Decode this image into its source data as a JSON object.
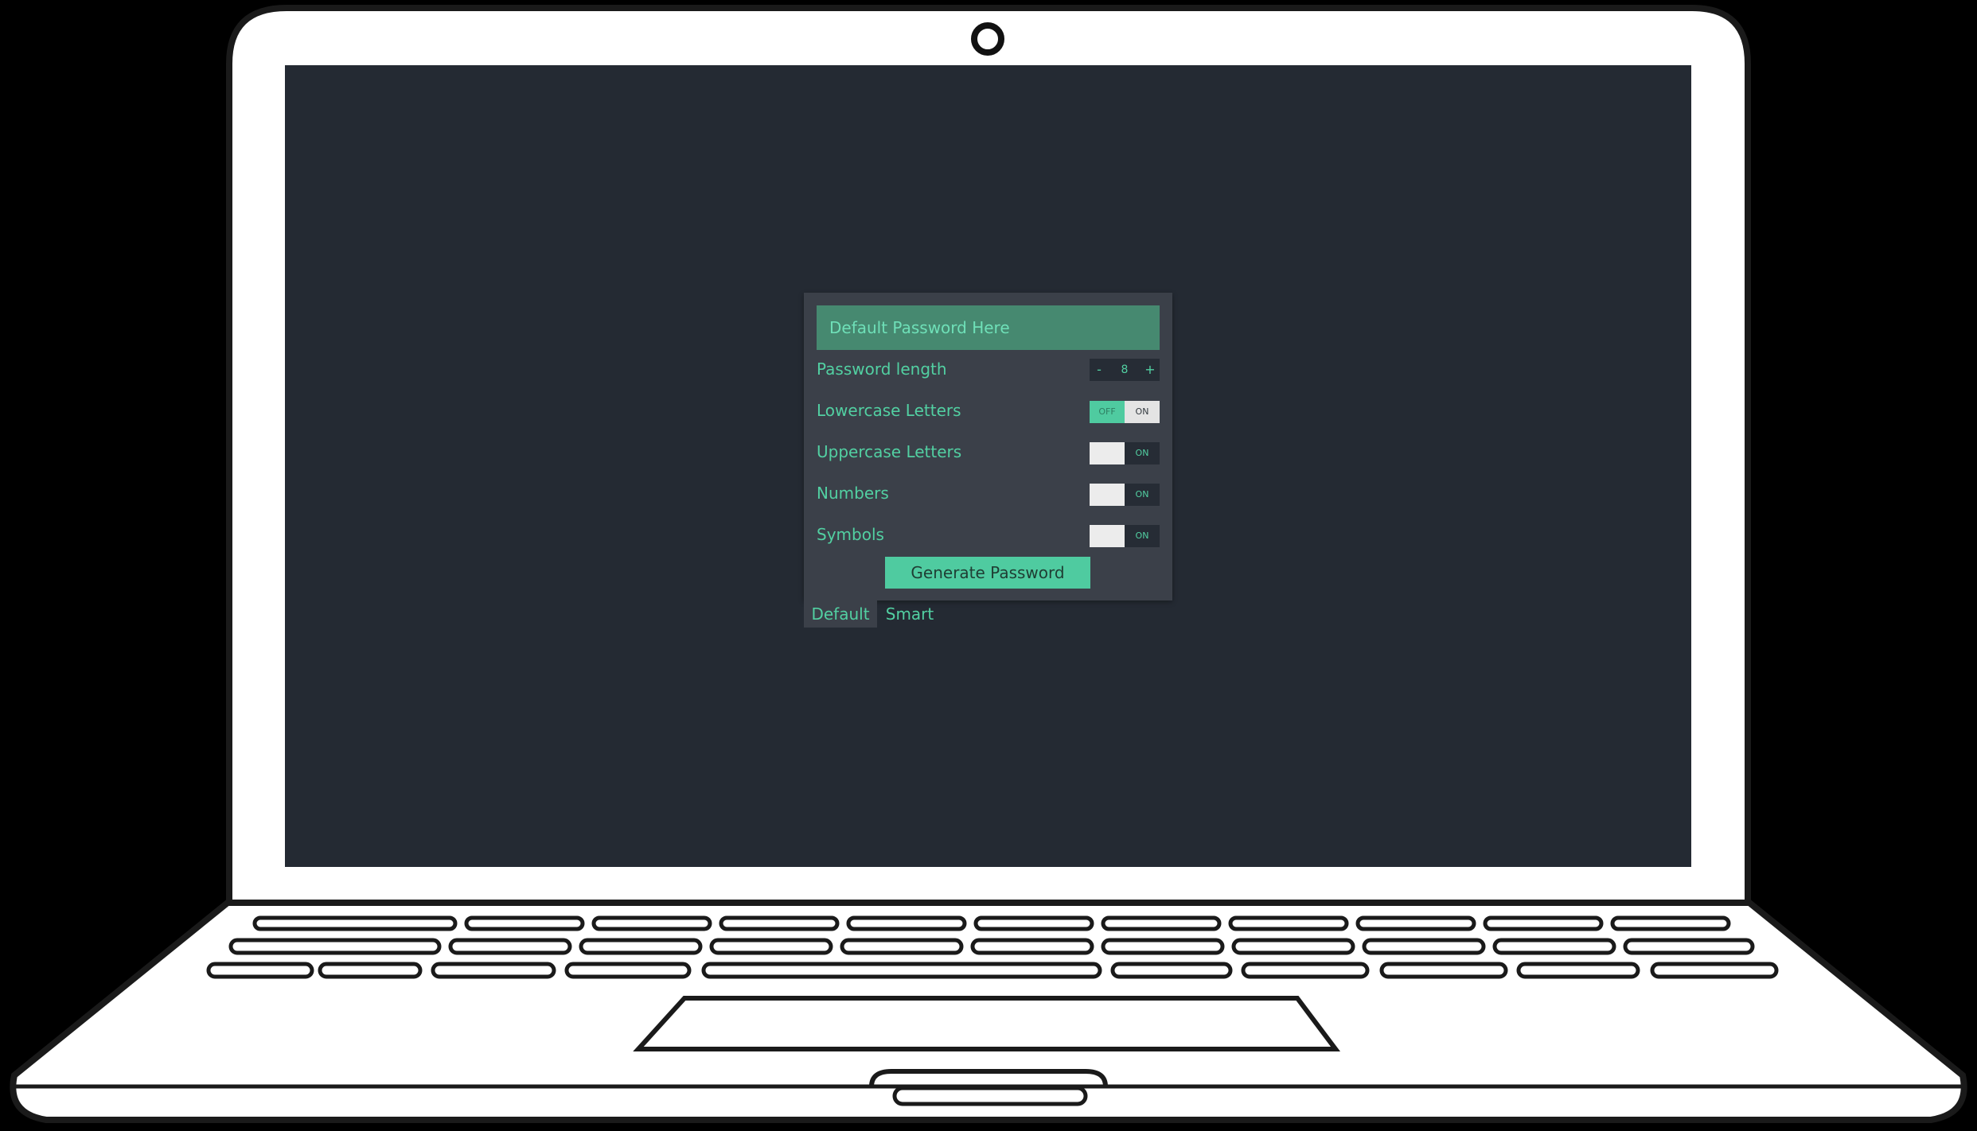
{
  "app": {
    "password_display": "Default Password Here",
    "length_label": "Password length",
    "length_value": "8",
    "decrement_symbol": "-",
    "increment_symbol": "+",
    "options": [
      {
        "label": "Lowercase Letters",
        "off_label": "OFF",
        "on_label": "ON",
        "selected": "off"
      },
      {
        "label": "Uppercase Letters",
        "off_label": "",
        "on_label": "ON",
        "selected": "on"
      },
      {
        "label": "Numbers",
        "off_label": "",
        "on_label": "ON",
        "selected": "on"
      },
      {
        "label": "Symbols",
        "off_label": "",
        "on_label": "ON",
        "selected": "on"
      }
    ],
    "generate_label": "Generate Password",
    "tabs": [
      {
        "label": "Default",
        "active": true
      },
      {
        "label": "Smart",
        "active": false
      }
    ]
  },
  "colors": {
    "screen_bg": "#242a33",
    "panel_bg": "#3b4049",
    "accent": "#4fcba0",
    "text_accent": "#52d0a2"
  }
}
